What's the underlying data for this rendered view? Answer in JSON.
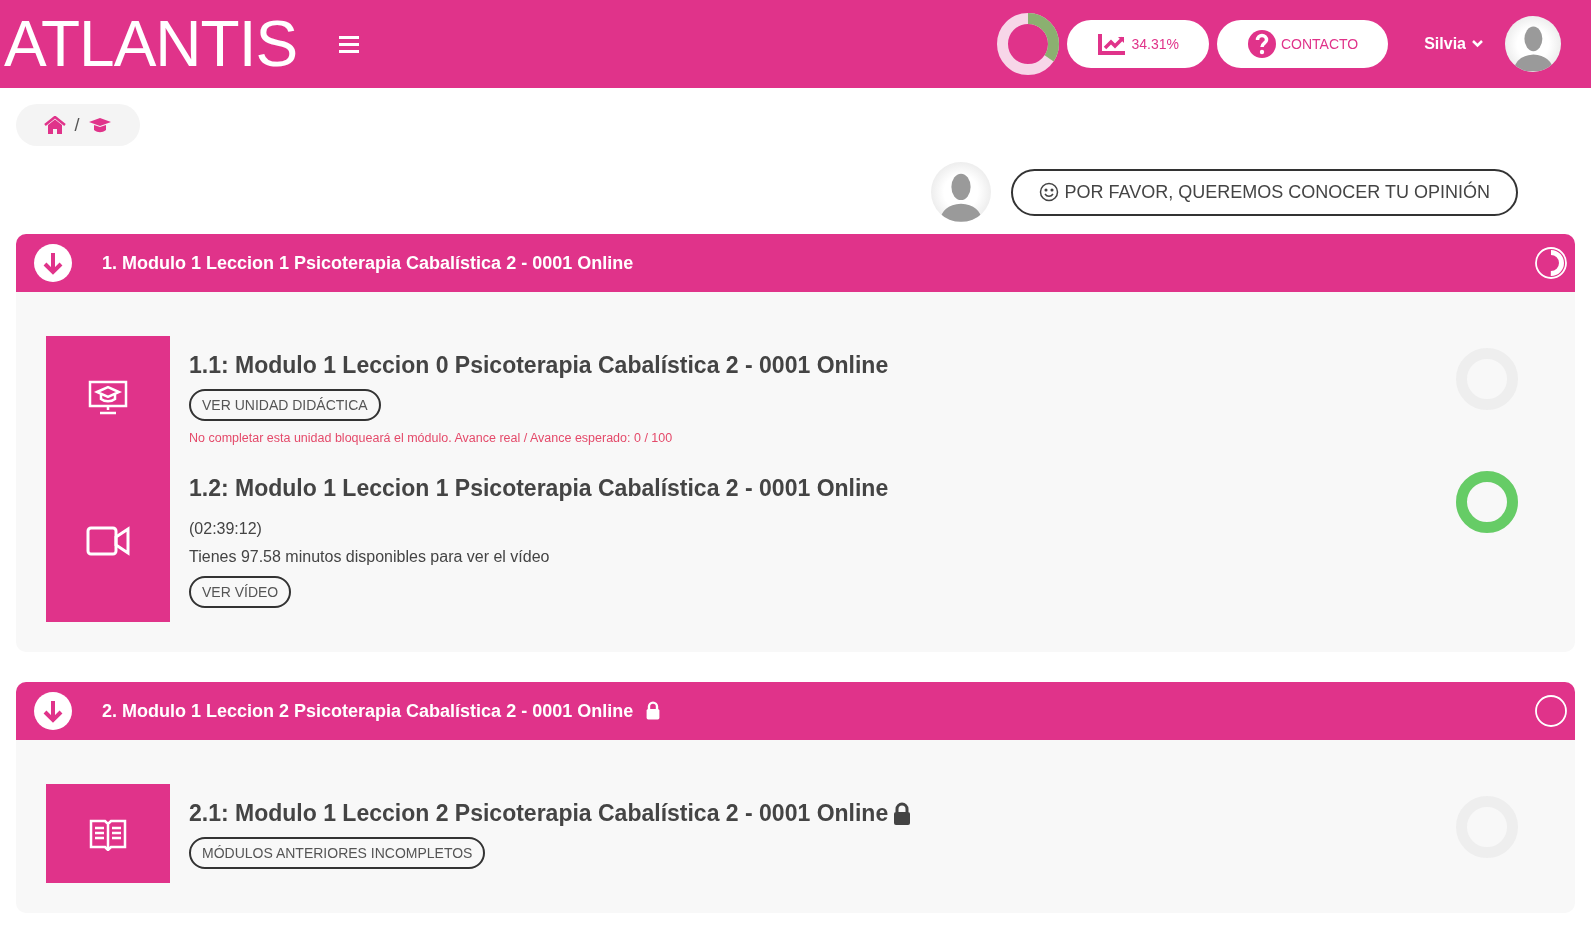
{
  "header": {
    "logo": "ATLANTIS",
    "progress": {
      "level": 0.3431
    },
    "stat": "34.31%",
    "contact": "CONTACTO",
    "user": "Silvia"
  },
  "breadcrumb_separator": "/",
  "feedback": "POR FAVOR, QUEREMOS CONOCER TU OPINIÓN",
  "modules": [
    {
      "title": "1. Modulo 1 Leccion 1 Psicoterapia Cabalística 2 - 0001 Online",
      "locked": false,
      "level": 0.5,
      "units": [
        {
          "kind": "presentation",
          "title": "1.1: Modulo 1 Leccion 0 Psicoterapia Cabalística 2 - 0001 Online",
          "locked": false,
          "level": 0,
          "button": "VER UNIDAD DIDÁCTICA",
          "warning": "No completar esta unidad bloqueará el módulo. Avance real / Avance esperado: 0 / 100"
        },
        {
          "kind": "video",
          "title": "1.2: Modulo 1 Leccion 1 Psicoterapia Cabalística 2 - 0001 Online",
          "locked": false,
          "level": 1,
          "duration": "(02:39:12)",
          "note": "Tienes 97.58 minutos disponibles para ver el vídeo",
          "button": "VER VÍDEO"
        }
      ]
    },
    {
      "title": "2. Modulo 1 Leccion 2 Psicoterapia Cabalística 2 - 0001 Online",
      "locked": true,
      "level": 0,
      "units": [
        {
          "kind": "book",
          "title": "2.1: Modulo 1 Leccion 2 Psicoterapia Cabalística 2 - 0001 Online",
          "locked": true,
          "level": 0,
          "button": "MÓDULOS ANTERIORES INCOMPLETOS"
        }
      ]
    }
  ]
}
